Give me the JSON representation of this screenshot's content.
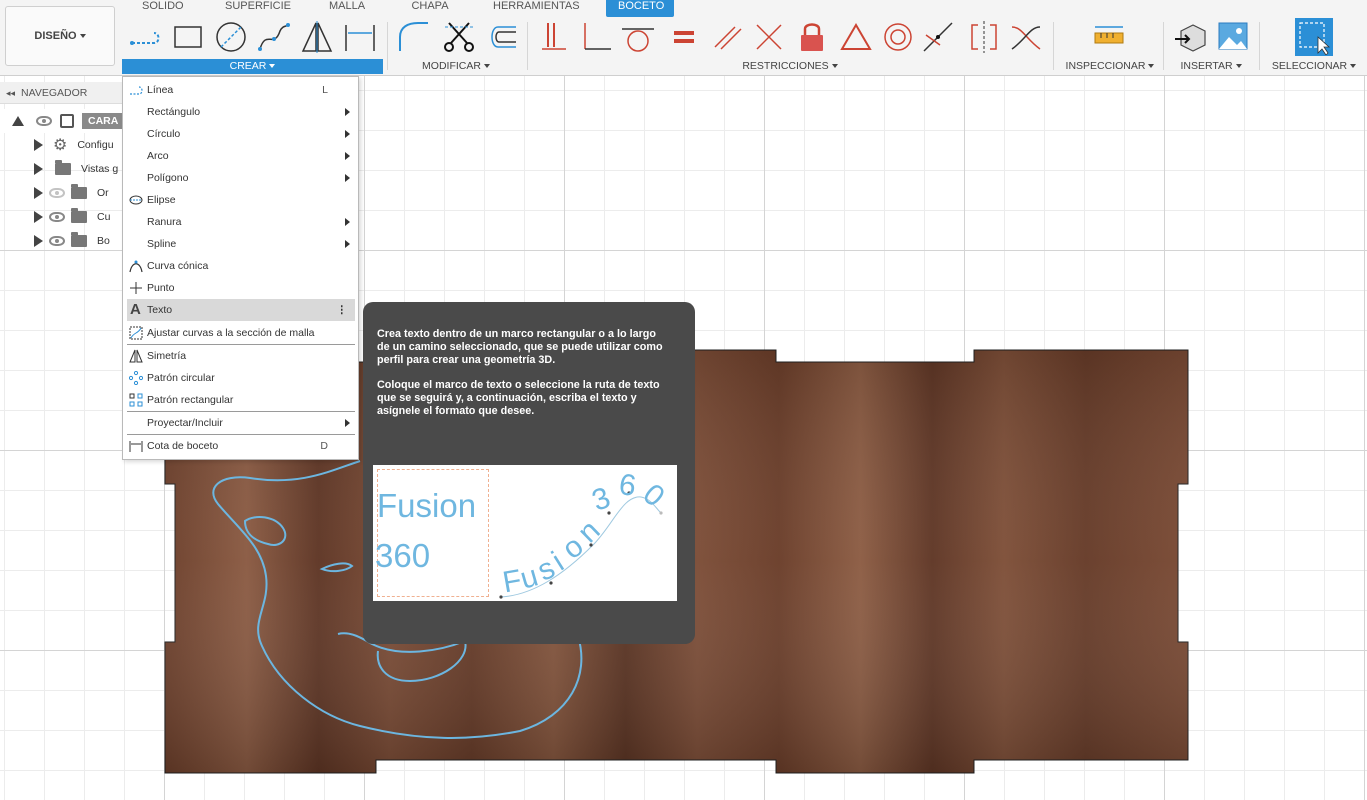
{
  "toolbar": {
    "workspace_label": "DISEÑO",
    "tabs": [
      "SOLIDO",
      "SUPERFICIE",
      "MALLA",
      "CHAPA",
      "HERRAMIENTAS",
      "BOCETO"
    ],
    "groups": {
      "create": "CREAR",
      "modify": "MODIFICAR",
      "constraints": "RESTRICCIONES",
      "inspect": "INSPECCIONAR",
      "insert": "INSERTAR",
      "select": "SELECCIONAR"
    },
    "accent_color": "#2b8fd6"
  },
  "navigator": {
    "title": "NAVEGADOR",
    "items": [
      "CARA",
      "Configu",
      "Vistas g",
      "Or",
      "Cu",
      "Bo"
    ]
  },
  "create_menu": {
    "items": [
      {
        "label": "Línea",
        "shortcut": "L"
      },
      {
        "label": "Rectángulo"
      },
      {
        "label": "Círculo"
      },
      {
        "label": "Arco"
      },
      {
        "label": "Polígono"
      },
      {
        "label": "Elipse"
      },
      {
        "label": "Ranura"
      },
      {
        "label": "Spline"
      },
      {
        "label": "Curva cónica"
      },
      {
        "label": "Punto"
      },
      {
        "label": "Texto"
      },
      {
        "label": "Ajustar curvas a la sección de malla"
      },
      {
        "label": "Simetría"
      },
      {
        "label": "Patrón circular"
      },
      {
        "label": "Patrón rectangular"
      },
      {
        "label": "Proyectar/Incluir"
      },
      {
        "label": "Cota de boceto",
        "shortcut": "D"
      }
    ]
  },
  "tooltip": {
    "paragraph1": "Crea texto dentro de un marco rectangular o a lo largo de un camino seleccionado, que se puede utilizar como perfil para crear una geometría 3D.",
    "paragraph2": "Coloque el marco de texto o seleccione la ruta de texto que se seguirá y, a continuación, escriba el texto y asígnele el formato que desee.",
    "image": {
      "frame_text_line1": "Fusion",
      "frame_text_line2": "360",
      "path_text_chars": [
        "F",
        "u",
        "s",
        "i",
        "o",
        "n",
        "3",
        "6",
        "0"
      ],
      "text_color": "#6fb7e0"
    }
  },
  "colors": {
    "sketch_curve": "#6cb6e0",
    "wood_dark": "#5a3322",
    "wood_light": "#8a5a40",
    "tooltip_bg": "#4a4a4a"
  }
}
